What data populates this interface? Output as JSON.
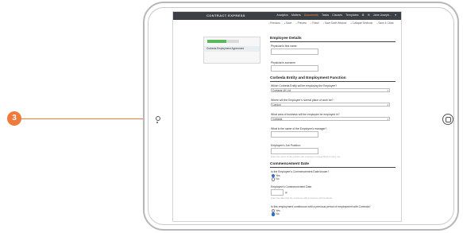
{
  "callout": {
    "number": "3"
  },
  "app": {
    "logo": "CONTRACT EXPRESS",
    "nav": [
      "Analytics",
      "Matters",
      "Documents",
      "Tasks",
      "Clauses",
      "Templates",
      "⚙",
      "✉",
      "Jane.Joseph...",
      "▾"
    ],
    "active_nav": "Documents"
  },
  "subnav": [
    {
      "label": "Previous",
      "state": "pending"
    },
    {
      "label": "Save",
      "state": "done"
    },
    {
      "label": "Preview",
      "state": "pending"
    },
    {
      "label": "Finish",
      "state": "pending"
    },
    {
      "label": "Save Draft Window",
      "state": "pending"
    },
    {
      "label": "Collapse Sections",
      "state": "done"
    },
    {
      "label": "Save & Close",
      "state": "pending"
    }
  ],
  "sidebar": {
    "progress": 0.6,
    "progress_color": "#5cb85c",
    "item": "Corbeda Employment Agreement"
  },
  "form": {
    "section1": "Employee Details",
    "first_name_label": "Physician's first name",
    "surname_label": "Physician's surname",
    "section2": "Corbeda Entity and Employment Function",
    "entity_label": "Which Corbeda Entity will be employing the Employee?",
    "entity_value": "Corbeda UK Ltd",
    "place_label": "Where will the Employee's normal place of work be?",
    "place_value": "London",
    "area_label": "What area of business will the employee be employed in?",
    "area_value": "Corbeda",
    "manager_label": "What is the name of the Employee's manager?",
    "job_label": "Employee's Job Position:",
    "job_hint": "Enter the name of the position the employee is being hired to carry out",
    "section3": "Commencement Date",
    "commence_q": "Is the Employee's Commencement Date known?",
    "commence_yes": "Yes",
    "commence_no": "No",
    "commence_date_label": "Employee's Commencement Date",
    "date_hint": "Enter the date that the employee will commence with Corbeda",
    "continuous_q": "Is this employment continuous with a previous period of employment with Corbeda?",
    "continuous_yes": "Yes",
    "continuous_no": "No"
  },
  "colors": {
    "accent": "#ee7a3b",
    "topbar": "#3c3f44",
    "radio": "#2b6fc9"
  }
}
